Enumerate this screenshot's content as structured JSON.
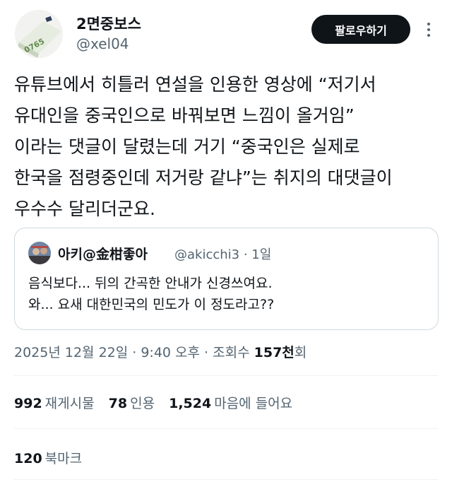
{
  "author": {
    "display_name": "2면중보스",
    "handle": "@xel04",
    "follow_label": "팔로우하기",
    "avatar_text": "0765"
  },
  "tweet": {
    "lines": [
      "유튜브에서 히틀러 연설을 인용한 영상에 “저기서",
      "유대인을 중국인으로 바꿔보면 느낌이 올거임”",
      "이라는 댓글이 달렸는데 거기 “중국인은 실제로",
      "한국을 점령중인데 저거랑 같냐”는 취지의 대댓글이",
      "우수수 달리더군요."
    ]
  },
  "quote": {
    "display_name": "아키@金柑좋아",
    "meta": "@akicchi3 · 1일",
    "lines": [
      "음식보다... 뒤의 간곡한 안내가 신경쓰여요.",
      "와... 요새 대한민국의 민도가 이 정도라고??"
    ]
  },
  "timestamp": {
    "text": "2025년 12월 22일 · 9:40 오후 · 조회수 ",
    "views_num": "157천",
    "views_suffix": "회"
  },
  "stats": {
    "retweets": {
      "num": "992",
      "label": "재게시물"
    },
    "quotes": {
      "num": "78",
      "label": "인용"
    },
    "likes": {
      "num": "1,524",
      "label": "마음에 들어요"
    },
    "bookmarks": {
      "num": "120",
      "label": "북마크"
    }
  }
}
